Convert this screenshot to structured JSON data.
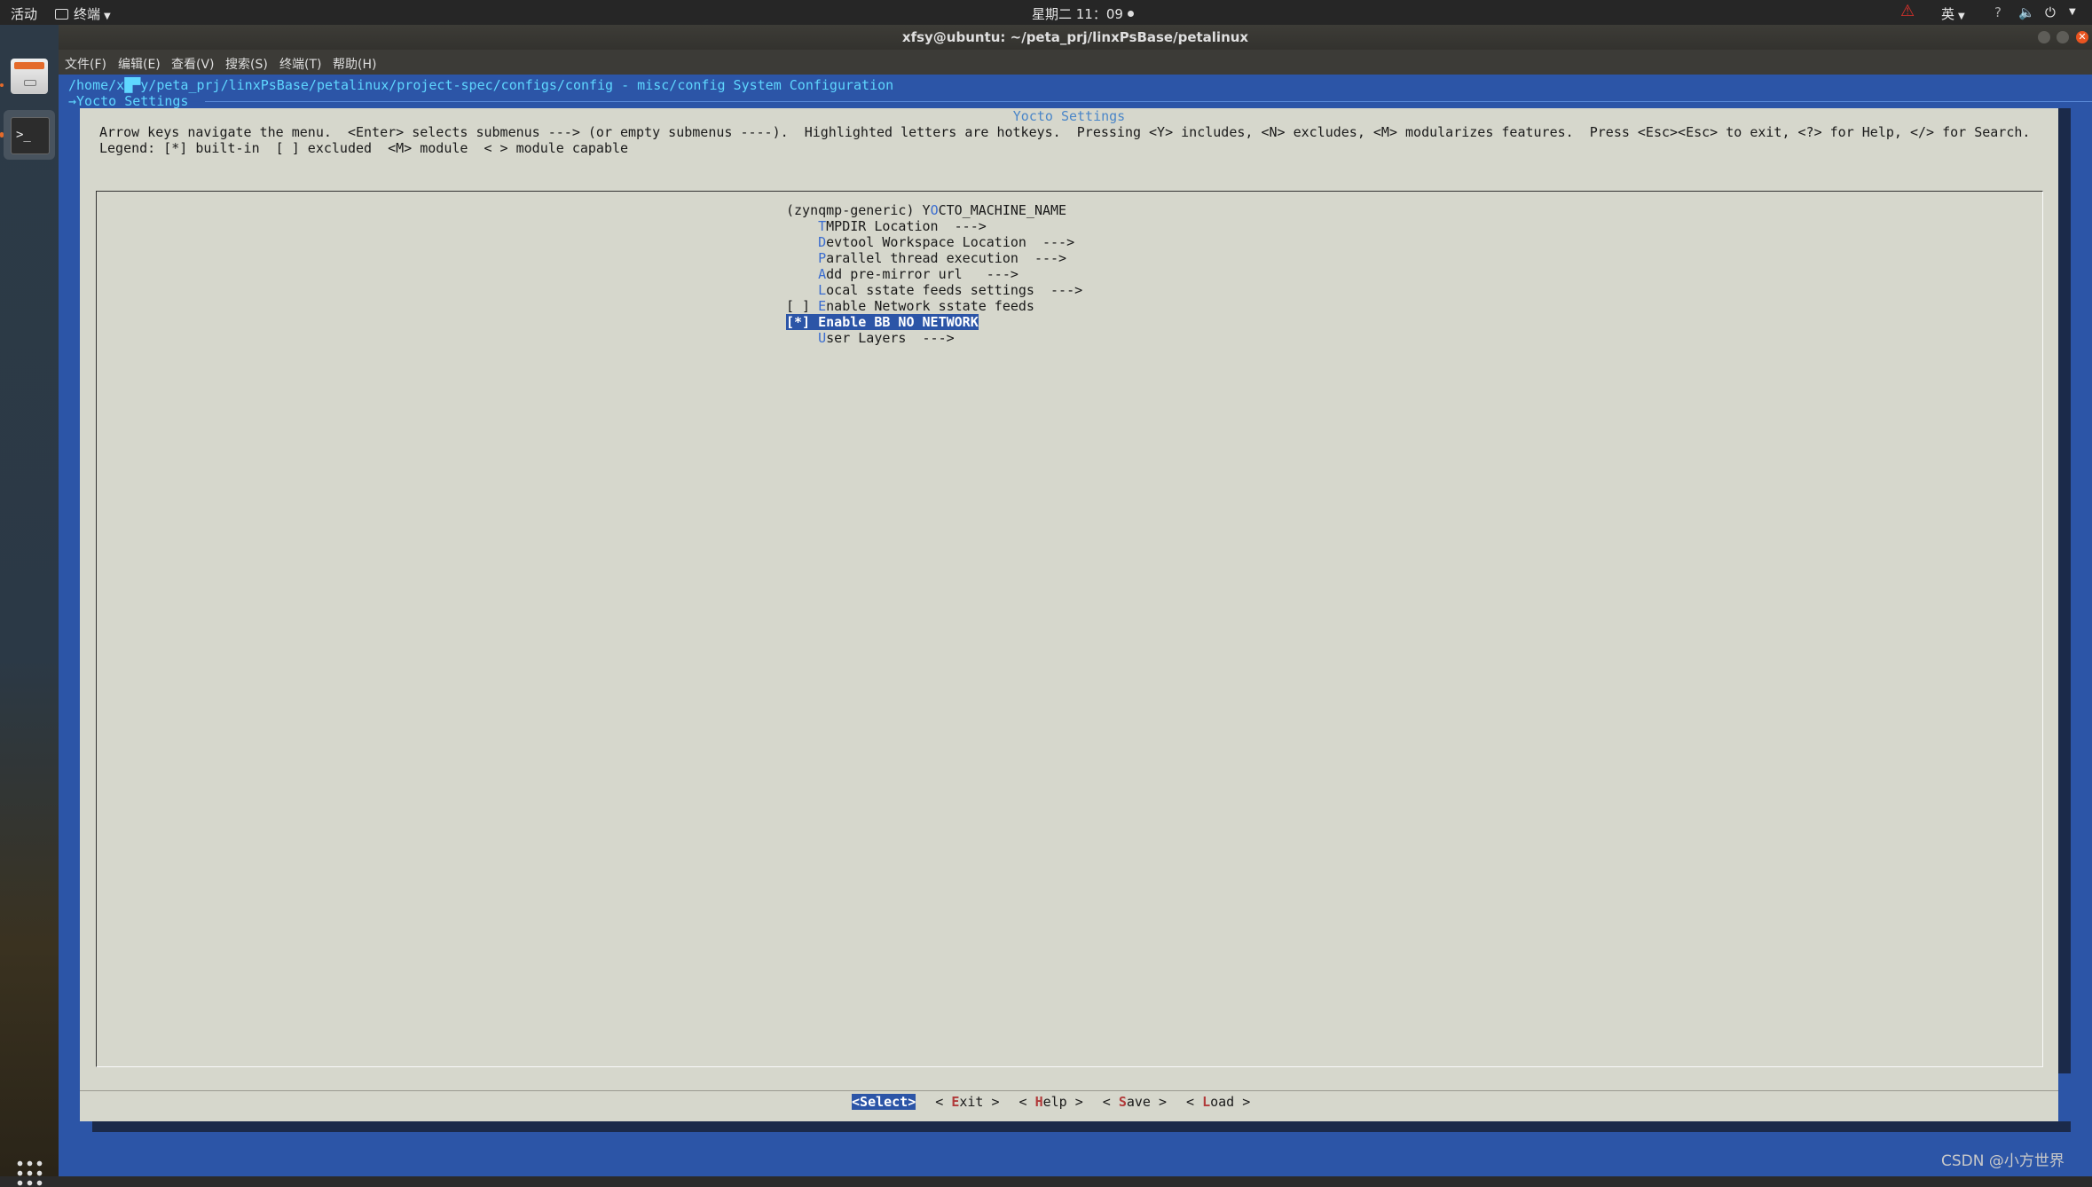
{
  "topbar": {
    "activities": "活动",
    "app_name": "终端",
    "clock": "星期二 11：09",
    "ime": "英",
    "icons": [
      "warning-icon",
      "network-icon",
      "volume-icon",
      "power-icon"
    ]
  },
  "window": {
    "title": "xfsy@ubuntu: ~/peta_prj/linxPsBase/petalinux",
    "menu": [
      "文件(F)",
      "编辑(E)",
      "查看(V)",
      "搜索(S)",
      "终端(T)",
      "帮助(H)"
    ]
  },
  "terminal": {
    "path_line": "/home/x█▀y/peta_prj/linxPsBase/petalinux/project-spec/configs/config - misc/config System Configuration",
    "breadcrumb": "→Yocto Settings",
    "dialog_title": "Yocto Settings",
    "instructions": [
      "Arrow keys navigate the menu.  <Enter> selects submenus ---> (or empty submenus ----).  Highlighted letters are hotkeys.  Pressing <Y> includes, <N> excludes, <M> modularizes features.  Press <Esc><Esc> to exit, <?> for Help, </> for Search.",
      "Legend: [*] built-in  [ ] excluded  <M> module  < > module capable"
    ],
    "items": [
      {
        "prefix": "(zynqmp-generic) ",
        "pre": "Y",
        "hotkey": "O",
        "rest": "CTO_MACHINE_NAME",
        "suffix": ""
      },
      {
        "prefix": "    ",
        "pre": "",
        "hotkey": "T",
        "rest": "MPDIR Location",
        "suffix": "  --->"
      },
      {
        "prefix": "    ",
        "pre": "",
        "hotkey": "D",
        "rest": "evtool Workspace Location",
        "suffix": "  --->"
      },
      {
        "prefix": "    ",
        "pre": "",
        "hotkey": "P",
        "rest": "arallel thread execution",
        "suffix": "  --->"
      },
      {
        "prefix": "    ",
        "pre": "",
        "hotkey": "A",
        "rest": "dd pre-mirror url",
        "suffix": "   --->"
      },
      {
        "prefix": "    ",
        "pre": "",
        "hotkey": "L",
        "rest": "ocal sstate feeds settings",
        "suffix": "  --->"
      },
      {
        "prefix": "[ ] ",
        "pre": "",
        "hotkey": "E",
        "rest": "nable Network sstate feeds",
        "suffix": ""
      },
      {
        "prefix": "[*] ",
        "pre": "",
        "hotkey": "E",
        "rest": "nable BB NO NETWORK",
        "suffix": "",
        "selected": true
      },
      {
        "prefix": "    ",
        "pre": "",
        "hotkey": "U",
        "rest": "ser Layers",
        "suffix": "  --->"
      }
    ],
    "buttons": [
      {
        "left": "<",
        "hotkey": "S",
        "rest": "elect",
        "right": ">",
        "active": true
      },
      {
        "left": "< ",
        "hotkey": "E",
        "rest": "xit",
        "right": " >"
      },
      {
        "left": "< ",
        "hotkey": "H",
        "rest": "elp",
        "right": " >"
      },
      {
        "left": "< ",
        "hotkey": "S",
        "rest": "ave",
        "right": " >"
      },
      {
        "left": "< ",
        "hotkey": "L",
        "rest": "oad",
        "right": " >"
      }
    ]
  },
  "watermark": "CSDN @小方世界",
  "colors": {
    "terminal_bg": "#2c55a7",
    "dialog_bg": "#d6d7cc",
    "hotkey": "#3a6ccf",
    "button_hotkey": "#b13a3a",
    "path_text": "#5fd7ff",
    "ubuntu_orange": "#e95420"
  }
}
